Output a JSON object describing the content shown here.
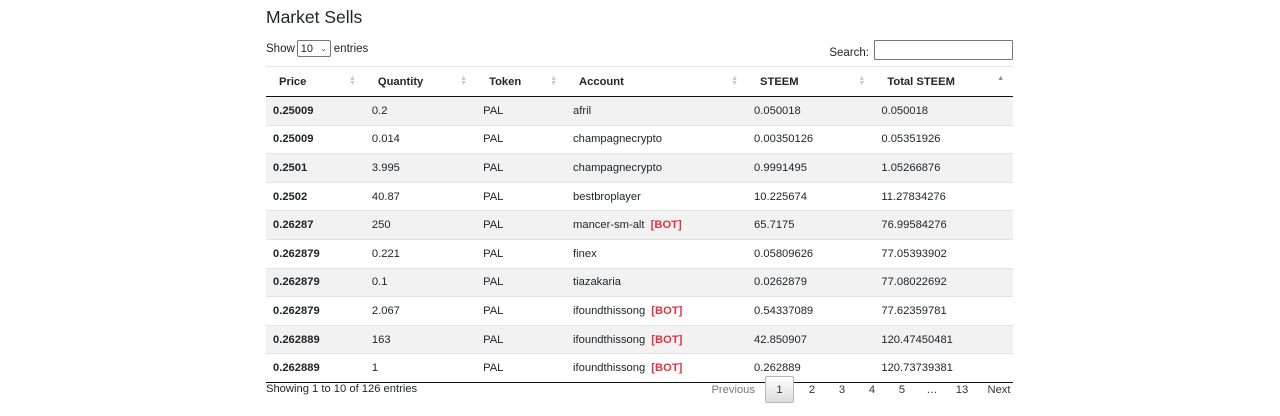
{
  "title": "Market Sells",
  "length": {
    "prefix": "Show",
    "value": "10",
    "suffix": "entries"
  },
  "search": {
    "label": "Search:",
    "value": ""
  },
  "columns": [
    "Price",
    "Quantity",
    "Token",
    "Account",
    "STEEM",
    "Total STEEM"
  ],
  "sorted_column": "Total STEEM",
  "rows": [
    {
      "price": "0.25009",
      "quantity": "0.2",
      "token": "PAL",
      "account": "afril",
      "bot": "",
      "steem": "0.050018",
      "total": "0.050018"
    },
    {
      "price": "0.25009",
      "quantity": "0.014",
      "token": "PAL",
      "account": "champagnecrypto",
      "bot": "",
      "steem": "0.00350126",
      "total": "0.05351926"
    },
    {
      "price": "0.2501",
      "quantity": "3.995",
      "token": "PAL",
      "account": "champagnecrypto",
      "bot": "",
      "steem": "0.9991495",
      "total": "1.05266876"
    },
    {
      "price": "0.2502",
      "quantity": "40.87",
      "token": "PAL",
      "account": "bestbroplayer",
      "bot": "",
      "steem": "10.225674",
      "total": "11.27834276"
    },
    {
      "price": "0.26287",
      "quantity": "250",
      "token": "PAL",
      "account": "mancer-sm-alt",
      "bot": "[BOT]",
      "steem": "65.7175",
      "total": "76.99584276"
    },
    {
      "price": "0.262879",
      "quantity": "0.221",
      "token": "PAL",
      "account": "finex",
      "bot": "",
      "steem": "0.05809626",
      "total": "77.05393902"
    },
    {
      "price": "0.262879",
      "quantity": "0.1",
      "token": "PAL",
      "account": "tiazakaria",
      "bot": "",
      "steem": "0.0262879",
      "total": "77.08022692"
    },
    {
      "price": "0.262879",
      "quantity": "2.067",
      "token": "PAL",
      "account": "ifoundthissong",
      "bot": "[BOT]",
      "steem": "0.54337089",
      "total": "77.62359781"
    },
    {
      "price": "0.262889",
      "quantity": "163",
      "token": "PAL",
      "account": "ifoundthissong",
      "bot": "[BOT]",
      "steem": "42.850907",
      "total": "120.47450481"
    },
    {
      "price": "0.262889",
      "quantity": "1",
      "token": "PAL",
      "account": "ifoundthissong",
      "bot": "[BOT]",
      "steem": "0.262889",
      "total": "120.73739381"
    }
  ],
  "info": "Showing 1 to 10 of 126 entries",
  "pagination": {
    "previous": "Previous",
    "pages": [
      "1",
      "2",
      "3",
      "4",
      "5",
      "…",
      "13"
    ],
    "current": "1",
    "next": "Next"
  },
  "colors": {
    "bot": "#dc3545",
    "stripe": "#f2f2f2",
    "sort_active": "#6a8fd6"
  }
}
